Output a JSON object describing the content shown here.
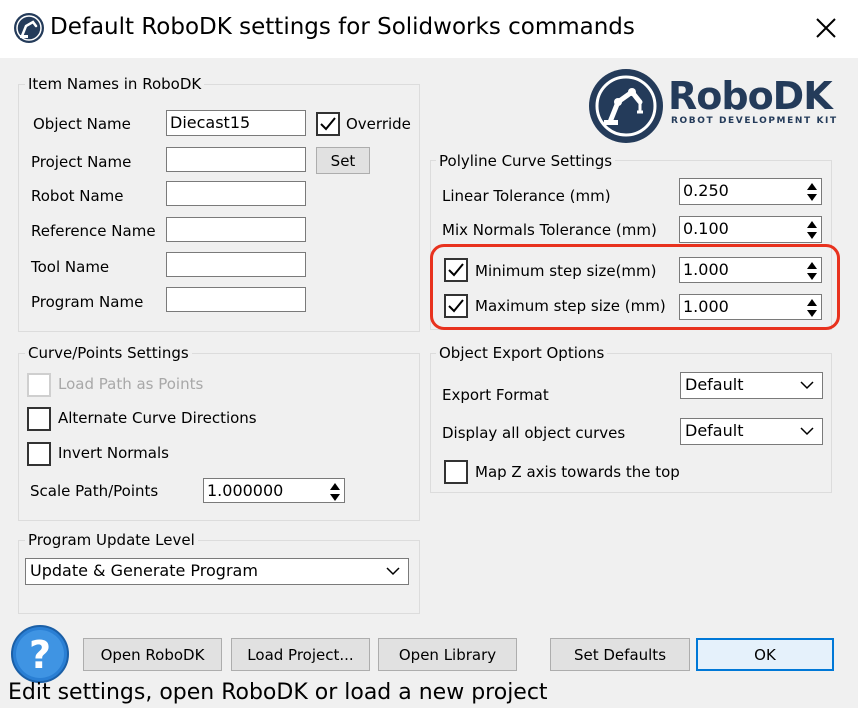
{
  "window": {
    "title": "Default RoboDK settings for Solidworks commands",
    "app_icon": "robodk-icon",
    "close_icon": "close-icon"
  },
  "logo": {
    "name": "RoboDK",
    "tagline": "ROBOT DEVELOPMENT KIT",
    "brand_color": "#243b5a",
    "accent_color": "#e8321e"
  },
  "item_names": {
    "title": "Item Names in RoboDK",
    "object_name_label": "Object Name",
    "object_name_value": "Diecast15",
    "override_label": "Override",
    "override_checked": true,
    "project_name_label": "Project Name",
    "project_name_value": "",
    "set_label": "Set",
    "robot_name_label": "Robot Name",
    "robot_name_value": "",
    "reference_name_label": "Reference Name",
    "reference_name_value": "",
    "tool_name_label": "Tool Name",
    "tool_name_value": "",
    "program_name_label": "Program Name",
    "program_name_value": ""
  },
  "curve_points": {
    "title": "Curve/Points Settings",
    "load_path_label": "Load Path as Points",
    "load_path_checked": false,
    "alternate_label": "Alternate Curve Directions",
    "alternate_checked": false,
    "invert_label": "Invert Normals",
    "invert_checked": false,
    "scale_label": "Scale Path/Points",
    "scale_value": "1.000000"
  },
  "program_update": {
    "title": "Program Update Level",
    "selected": "Update & Generate Program"
  },
  "polyline": {
    "title": "Polyline Curve Settings",
    "linear_label": "Linear Tolerance (mm)",
    "linear_value": "0.250",
    "mix_label": "Mix Normals Tolerance (mm)",
    "mix_value": "0.100",
    "min_step_label": "Minimum step size(mm)",
    "min_step_checked": true,
    "min_step_value": "1.000",
    "max_step_label": "Maximum step size (mm)",
    "max_step_checked": true,
    "max_step_value": "1.000",
    "highlight_color": "#e8321e"
  },
  "object_export": {
    "title": "Object Export Options",
    "format_label": "Export Format",
    "format_value": "Default",
    "curves_label": "Display all object curves",
    "curves_value": "Default",
    "mapz_label": "Map Z axis towards the top",
    "mapz_checked": false
  },
  "buttons": {
    "help_icon": "help-icon",
    "open_robodk": "Open RoboDK",
    "load_project": "Load Project...",
    "open_library": "Open Library",
    "set_defaults": "Set Defaults",
    "ok": "OK"
  },
  "status": {
    "text": "Edit settings, open RoboDK or load a new project"
  }
}
